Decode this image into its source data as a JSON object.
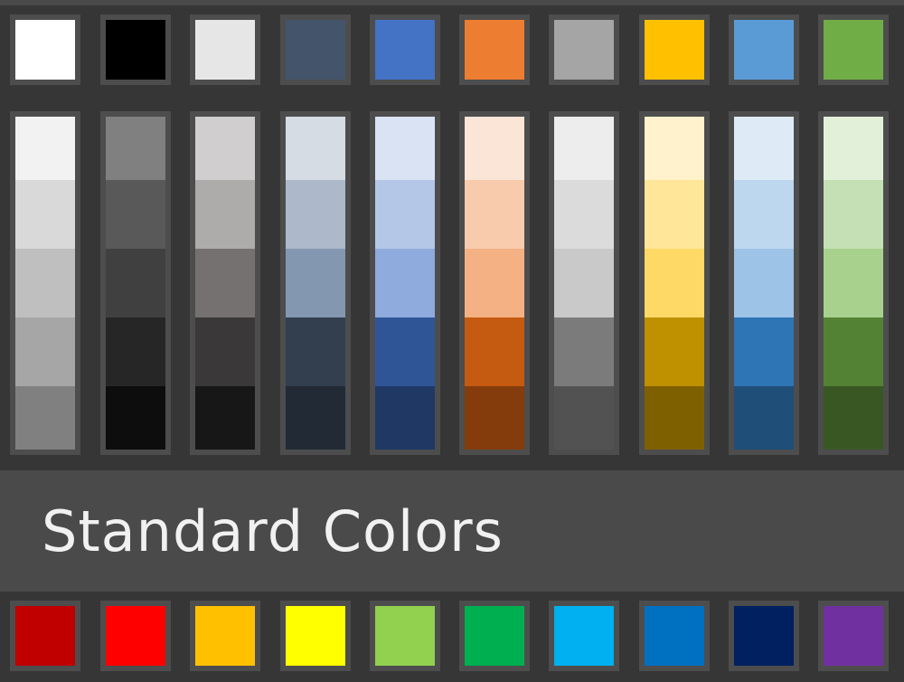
{
  "theme_colors": [
    {
      "name": "white",
      "hex": "#ffffff"
    },
    {
      "name": "black",
      "hex": "#000000"
    },
    {
      "name": "light-gray",
      "hex": "#e7e6e6"
    },
    {
      "name": "dark-blue-gray",
      "hex": "#44546a"
    },
    {
      "name": "blue",
      "hex": "#4472c4"
    },
    {
      "name": "orange",
      "hex": "#ed7d31"
    },
    {
      "name": "gray",
      "hex": "#a5a5a5"
    },
    {
      "name": "gold",
      "hex": "#ffc000"
    },
    {
      "name": "light-blue",
      "hex": "#5b9bd5"
    },
    {
      "name": "green",
      "hex": "#70ad47"
    }
  ],
  "shade_columns": [
    {
      "name": "white",
      "shades": [
        "#f2f2f2",
        "#d9d9d9",
        "#bfbfbf",
        "#a6a6a6",
        "#808080"
      ]
    },
    {
      "name": "black",
      "shades": [
        "#808080",
        "#595959",
        "#404040",
        "#262626",
        "#0d0d0d"
      ]
    },
    {
      "name": "light-gray",
      "shades": [
        "#d0cece",
        "#aeabab",
        "#767171",
        "#3a3838",
        "#171717"
      ]
    },
    {
      "name": "dark-blue-gray",
      "shades": [
        "#d6dce4",
        "#adb9ca",
        "#8497b0",
        "#333f4f",
        "#222a35"
      ]
    },
    {
      "name": "blue",
      "shades": [
        "#dae3f3",
        "#b4c7e7",
        "#8faadc",
        "#2f5597",
        "#203864"
      ]
    },
    {
      "name": "orange",
      "shades": [
        "#fbe5d6",
        "#f8cbad",
        "#f4b183",
        "#c55a11",
        "#843c0c"
      ]
    },
    {
      "name": "gray",
      "shades": [
        "#ededed",
        "#dbdbdb",
        "#c9c9c9",
        "#7b7b7b",
        "#525252"
      ]
    },
    {
      "name": "gold",
      "shades": [
        "#fff2cc",
        "#ffe699",
        "#ffd966",
        "#bf9000",
        "#7f6000"
      ]
    },
    {
      "name": "light-blue",
      "shades": [
        "#deebf7",
        "#bdd7ee",
        "#9dc3e6",
        "#2e75b6",
        "#1f4e79"
      ]
    },
    {
      "name": "green",
      "shades": [
        "#e2f0d9",
        "#c5e0b4",
        "#a9d18e",
        "#548235",
        "#385723"
      ]
    }
  ],
  "standard_section": {
    "title": "Standard Colors"
  },
  "standard_colors": [
    {
      "name": "dark-red",
      "hex": "#c00000"
    },
    {
      "name": "red",
      "hex": "#ff0000"
    },
    {
      "name": "orange",
      "hex": "#ffc000"
    },
    {
      "name": "yellow",
      "hex": "#ffff00"
    },
    {
      "name": "light-green",
      "hex": "#92d050"
    },
    {
      "name": "green",
      "hex": "#00b050"
    },
    {
      "name": "light-blue",
      "hex": "#00b0f0"
    },
    {
      "name": "blue",
      "hex": "#0070c0"
    },
    {
      "name": "dark-blue",
      "hex": "#002060"
    },
    {
      "name": "purple",
      "hex": "#7030a0"
    }
  ]
}
